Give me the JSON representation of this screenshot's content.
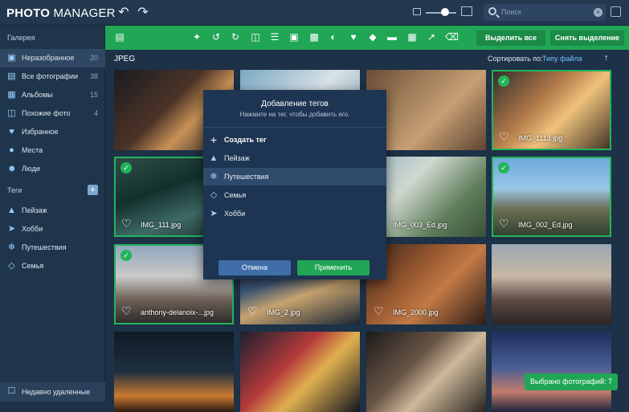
{
  "app": {
    "brand_bold": "PHOTO",
    "brand_rest": " MANAGER"
  },
  "header": {
    "search_placeholder": "Поиск"
  },
  "sidebar": {
    "gallery_heading": "Галерея",
    "items": [
      {
        "label": "Неразобранное",
        "count": "20",
        "icon": "inbox-icon"
      },
      {
        "label": "Все фотографии",
        "count": "38",
        "icon": "photos-icon"
      },
      {
        "label": "Альбомы",
        "count": "15",
        "icon": "albums-icon"
      },
      {
        "label": "Похожие фото",
        "count": "4",
        "icon": "similar-icon"
      },
      {
        "label": "Избранное",
        "count": "",
        "icon": "heart-icon"
      },
      {
        "label": "Места",
        "count": "",
        "icon": "pin-icon"
      },
      {
        "label": "Люди",
        "count": "",
        "icon": "person-icon"
      }
    ],
    "tags_heading": "Теги",
    "tags": [
      {
        "label": "Пейзаж",
        "icon": "landscape-tag-icon"
      },
      {
        "label": "Хобби",
        "icon": "hobby-tag-icon"
      },
      {
        "label": "Путешествия",
        "icon": "travel-tag-icon"
      },
      {
        "label": "Семья",
        "icon": "family-tag-icon"
      }
    ],
    "trash": "Недавно удаленные"
  },
  "toolbar": {
    "select_all": "Выделить все",
    "deselect": "Снять выделение"
  },
  "content": {
    "folder": "JPEG",
    "sort_label": "Сортировать по:",
    "sort_value": "Типу файла"
  },
  "photos": [
    {
      "name": "",
      "selected": false,
      "bg": "linear-gradient(135deg,#1b1c22 0%,#4c3326 45%,#c89257 65%,#1b1c22 100%)"
    },
    {
      "name": "",
      "selected": false,
      "bg": "linear-gradient(135deg,#7ba8c2 0%,#d9e3e8 50%,#6d8fa4 100%)"
    },
    {
      "name": "",
      "selected": false,
      "bg": "linear-gradient(135deg,#6a4b34 0%,#9a7a57 30%,#c79f74 60%,#5b4430 100%)"
    },
    {
      "name": "IMG_1113.jpg",
      "selected": true,
      "bg": "linear-gradient(135deg,#2e2a2a 0%,#b27a4a 40%,#f0c27b 60%,#3b3026 100%)"
    },
    {
      "name": "IMG_111.jpg",
      "selected": true,
      "bg": "linear-gradient(160deg,#2f4d4a 0%,#14302d 40%,#3e6a66 70%,#1a2c2b 100%)"
    },
    {
      "name": "",
      "selected": false,
      "bg": "linear-gradient(135deg,#203a52 0%,#1d3147 100%)"
    },
    {
      "name": "IMG_003_Ed.jpg",
      "selected": false,
      "bg": "linear-gradient(135deg,#9fb8c6 0%,#cfd8cf 35%,#5f7d5a 70%,#39513a 100%)"
    },
    {
      "name": "IMG_002_Ed.jpg",
      "selected": true,
      "bg": "linear-gradient(180deg,#6aa8d8 0%,#9ac6e6 40%,#6b6f56 65%,#2f3f2c 100%)"
    },
    {
      "name": "anthony-delanoix-...jpg",
      "selected": true,
      "bg": "linear-gradient(180deg,#8fa6bd 0%,#c9c9c6 40%,#6a5e55 70%,#2b2a2a 100%)"
    },
    {
      "name": "IMG_2.jpg",
      "selected": false,
      "bg": "linear-gradient(160deg,#1f2a3a 0%,#3c5675 40%,#c7a36f 60%,#1a2533 100%)"
    },
    {
      "name": "IMG_2000.jpg",
      "selected": false,
      "bg": "linear-gradient(135deg,#3b241b 0%,#9a5a31 40%,#c27a46 60%,#2d1c17 100%)"
    },
    {
      "name": "",
      "selected": false,
      "bg": "linear-gradient(180deg,#9aa6b2 0%,#c8b8a6 40%,#5b4a42 70%,#2a2624 100%)"
    },
    {
      "name": "",
      "selected": false,
      "bg": "linear-gradient(180deg,#0f1a26 0%,#1f2f3f 50%,#c97a32 80%,#2a1a12 100%)"
    },
    {
      "name": "",
      "selected": false,
      "bg": "linear-gradient(135deg,#1b2030 0%,#b33a3a 40%,#e0b050 60%,#14161f 100%)"
    },
    {
      "name": "",
      "selected": false,
      "bg": "linear-gradient(135deg,#1c1a19 0%,#6b5748 40%,#cdb99a 60%,#2a2420 100%)"
    },
    {
      "name": "",
      "selected": false,
      "bg": "linear-gradient(180deg,#1d2f5a 0%,#4a5f96 45%,#c27a6a 75%,#1d2440 100%)"
    }
  ],
  "dialog": {
    "title": "Добавление тегов",
    "subtitle": "Нажмите на тег, чтобы добавить его.",
    "create": "Создать тег",
    "tags": [
      "Пейзаж",
      "Путешествия",
      "Семья",
      "Хобби"
    ],
    "cancel": "Отмена",
    "apply": "Применить"
  },
  "footer": {
    "selected_count": "Выбрано фотографий: 7"
  }
}
